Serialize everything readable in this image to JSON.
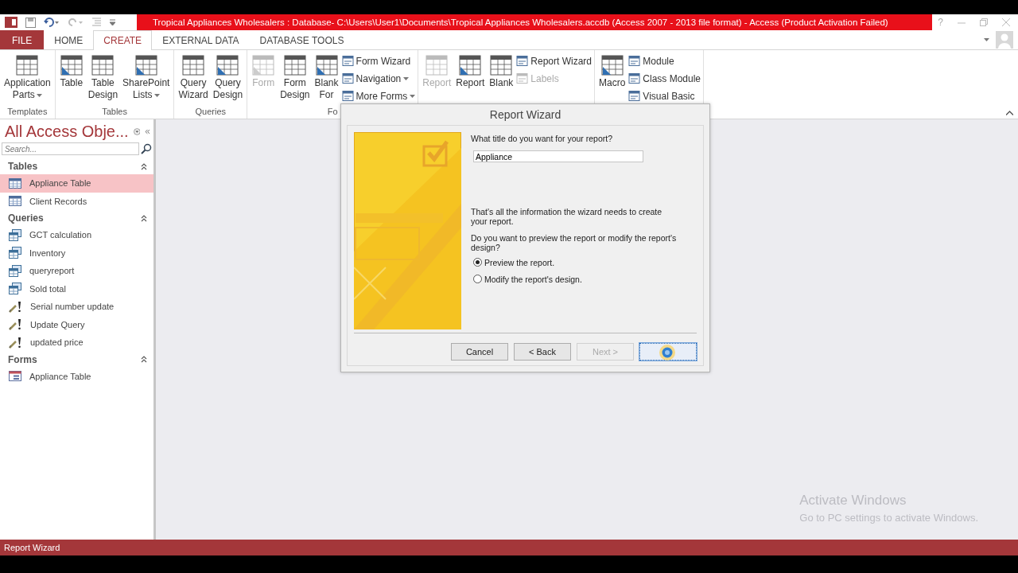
{
  "window": {
    "title": "Tropical Appliances Wholesalers : Database- C:\\Users\\User1\\Documents\\Tropical Appliances Wholesalers.accdb (Access 2007 - 2013 file format) -  Access (Product Activation Failed)",
    "help": "?"
  },
  "tabs": [
    {
      "label": "FILE",
      "kind": "file",
      "selected": false
    },
    {
      "label": "HOME",
      "kind": "tab",
      "selected": false
    },
    {
      "label": "CREATE",
      "kind": "tab",
      "selected": true
    },
    {
      "label": "EXTERNAL DATA",
      "kind": "tab",
      "selected": false
    },
    {
      "label": "DATABASE TOOLS",
      "kind": "tab",
      "selected": false
    }
  ],
  "ribbon": {
    "groups": [
      {
        "label": "Templates",
        "items": [
          {
            "kind": "large",
            "lines": [
              "Application",
              "Parts"
            ],
            "dropdown": true,
            "disabled": false
          }
        ]
      },
      {
        "label": "Tables",
        "items": [
          {
            "kind": "large",
            "lines": [
              "Table"
            ],
            "dropdown": false,
            "disabled": false
          },
          {
            "kind": "large",
            "lines": [
              "Table",
              "Design"
            ],
            "dropdown": false,
            "disabled": false
          },
          {
            "kind": "large",
            "lines": [
              "SharePoint",
              "Lists"
            ],
            "dropdown": true,
            "disabled": false
          }
        ]
      },
      {
        "label": "Queries",
        "items": [
          {
            "kind": "large",
            "lines": [
              "Query",
              "Wizard"
            ],
            "dropdown": false,
            "disabled": false
          },
          {
            "kind": "large",
            "lines": [
              "Query",
              "Design"
            ],
            "dropdown": false,
            "disabled": false
          }
        ]
      },
      {
        "label": "Fo",
        "items": [
          {
            "kind": "large",
            "lines": [
              "Form"
            ],
            "dropdown": false,
            "disabled": true
          },
          {
            "kind": "large",
            "lines": [
              "Form",
              "Design"
            ],
            "dropdown": false,
            "disabled": false
          },
          {
            "kind": "large",
            "lines": [
              "Blank",
              "For"
            ],
            "dropdown": false,
            "disabled": false
          },
          {
            "kind": "stack",
            "buttons": [
              {
                "label": "Form Wizard",
                "dropdown": false,
                "disabled": false
              },
              {
                "label": "Navigation",
                "dropdown": true,
                "disabled": false
              },
              {
                "label": "More Forms",
                "dropdown": true,
                "disabled": false
              }
            ]
          }
        ]
      },
      {
        "items": [
          {
            "kind": "large",
            "lines": [
              "Report"
            ],
            "dropdown": false,
            "disabled": true
          },
          {
            "kind": "large",
            "lines": [
              "Report"
            ],
            "dropdown": false,
            "disabled": false
          },
          {
            "kind": "large",
            "lines": [
              "Blank"
            ],
            "dropdown": false,
            "disabled": false
          },
          {
            "kind": "stack",
            "buttons": [
              {
                "label": "Report Wizard",
                "dropdown": false,
                "disabled": false
              },
              {
                "label": "Labels",
                "dropdown": false,
                "disabled": true
              }
            ]
          }
        ]
      },
      {
        "items": [
          {
            "kind": "large",
            "lines": [
              "Macro"
            ],
            "dropdown": false,
            "disabled": false
          },
          {
            "kind": "stack",
            "buttons": [
              {
                "label": "Module",
                "dropdown": false,
                "disabled": false
              },
              {
                "label": "Class Module",
                "dropdown": false,
                "disabled": false
              },
              {
                "label": "Visual Basic",
                "dropdown": false,
                "disabled": false
              }
            ]
          }
        ]
      }
    ]
  },
  "nav": {
    "title": "All Access Obje...",
    "search": {
      "placeholder": "Search..."
    },
    "sections": [
      {
        "label": "Tables",
        "expanded": true,
        "items": [
          {
            "label": "Appliance Table",
            "kind": "table",
            "selected": true
          },
          {
            "label": "Client Records",
            "kind": "table",
            "selected": false
          }
        ]
      },
      {
        "label": "Queries",
        "expanded": true,
        "items": [
          {
            "label": "GCT calculation",
            "kind": "query",
            "selected": false
          },
          {
            "label": "Inventory",
            "kind": "query",
            "selected": false
          },
          {
            "label": "queryreport",
            "kind": "query",
            "selected": false
          },
          {
            "label": "Sold total",
            "kind": "query",
            "selected": false
          },
          {
            "label": "Serial number update",
            "kind": "action",
            "selected": false
          },
          {
            "label": "Update Query",
            "kind": "action",
            "selected": false
          },
          {
            "label": "updated price",
            "kind": "action",
            "selected": false
          }
        ]
      },
      {
        "label": "Forms",
        "expanded": true,
        "items": [
          {
            "label": "Appliance Table",
            "kind": "form",
            "selected": false
          }
        ]
      }
    ]
  },
  "dialog": {
    "title": "Report Wizard",
    "question": "What title do you want for your report?",
    "title_field": {
      "value": "Appliance"
    },
    "info": "That's all the information the wizard needs to create your report.",
    "question2": "Do you want to preview the report or modify the report's design?",
    "options": [
      {
        "label": "Preview the report.",
        "selected": true
      },
      {
        "label": "Modify the report's design.",
        "selected": false
      }
    ],
    "buttons": [
      {
        "label": "Cancel",
        "disabled": false,
        "focused": false
      },
      {
        "label": "< Back",
        "disabled": false,
        "focused": false
      },
      {
        "label": "Next >",
        "disabled": true,
        "focused": false
      },
      {
        "disabled": false,
        "focused": true
      }
    ]
  },
  "activation_notice": {
    "title": "Activate Windows",
    "subtitle": "Go to PC settings to activate Windows."
  },
  "status_bar": {
    "text": "Report Wizard"
  }
}
